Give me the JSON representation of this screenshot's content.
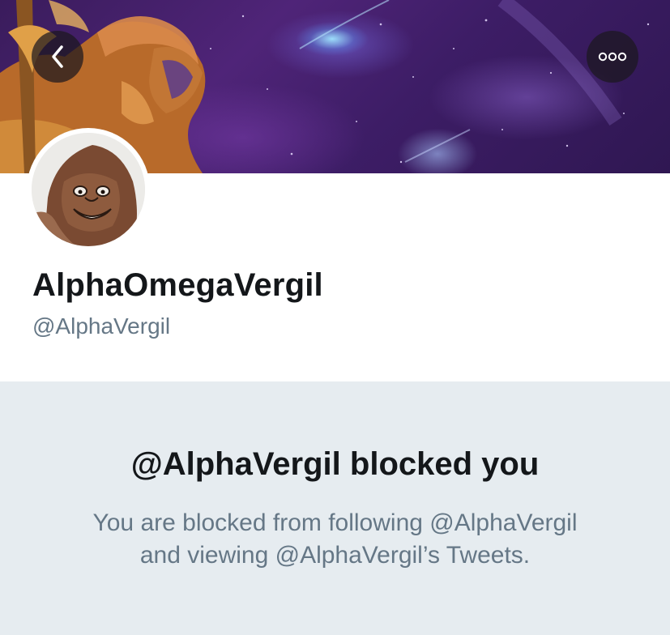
{
  "profile": {
    "display_name": "AlphaOmegaVergil",
    "handle": "@AlphaVergil",
    "avatar": "drawn-face-avatar",
    "banner": "cosmic-warrior-header"
  },
  "header": {
    "back_icon": "chevron-left-icon",
    "more_icon": "more-dots-icon"
  },
  "blocked": {
    "title": "@AlphaVergil blocked you",
    "line1": "You are blocked from following @AlphaVergil",
    "line2": "and viewing @AlphaVergil’s Tweets."
  },
  "colors": {
    "primary_text": "#14171a",
    "secondary_text": "#657786",
    "blocked_background": "#e6ecf0"
  }
}
